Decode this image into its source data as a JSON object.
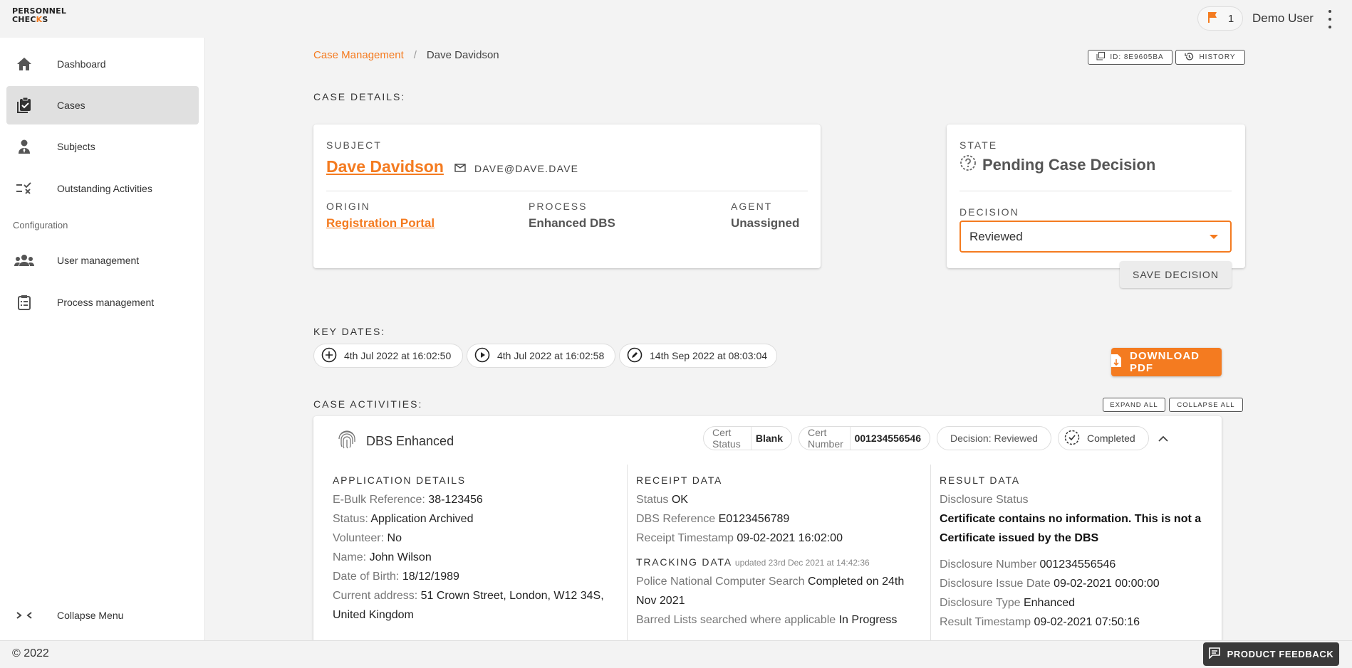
{
  "header": {
    "logo_line1": "PERSONNEL",
    "logo_line2_a": "CHEC",
    "logo_line2_k": "K",
    "logo_line2_b": "S",
    "flag_count": "1",
    "user_name": "Demo User"
  },
  "sidebar": {
    "items": [
      {
        "label": "Dashboard",
        "icon": "home-icon"
      },
      {
        "label": "Cases",
        "icon": "clipboard-check-icon"
      },
      {
        "label": "Subjects",
        "icon": "person-icon"
      },
      {
        "label": "Outstanding Activities",
        "icon": "checklist-icon"
      },
      {
        "label": "User management",
        "icon": "group-icon"
      },
      {
        "label": "Process management",
        "icon": "clipboard-list-icon"
      }
    ],
    "section_label": "Configuration",
    "collapse_label": "Collapse Menu"
  },
  "breadcrumb": {
    "parent": "Case Management",
    "separator": "/",
    "current": "Dave Davidson"
  },
  "actions": {
    "id_label": "ID: 8E9605BA",
    "history_label": "HISTORY"
  },
  "case_details": {
    "title": "CASE DETAILS:",
    "subject_label": "SUBJECT",
    "subject_name": "Dave Davidson",
    "subject_email": "DAVE@DAVE.DAVE",
    "origin_label": "ORIGIN",
    "origin_value": "Registration Portal",
    "process_label": "PROCESS",
    "process_value": "Enhanced DBS",
    "agent_label": "AGENT",
    "agent_value": "Unassigned"
  },
  "state": {
    "label": "STATE",
    "value": "Pending Case Decision",
    "decision_label": "DECISION",
    "decision_value": "Reviewed",
    "save_label": "SAVE DECISION"
  },
  "key_dates": {
    "title": "KEY DATES:",
    "created": "4th Jul 2022 at 16:02:50",
    "started": "4th Jul 2022 at 16:02:58",
    "edited": "14th Sep 2022 at 08:03:04",
    "download_label": "DOWNLOAD PDF"
  },
  "case_activities": {
    "title": "CASE ACTIVITIES:",
    "expand_all": "EXPAND ALL",
    "collapse_all": "COLLAPSE ALL",
    "activity": {
      "name": "DBS Enhanced",
      "cert_status_label": "Cert Status",
      "cert_status_value": "Blank",
      "cert_number_label": "Cert Number",
      "cert_number_value": "001234556546",
      "decision_text": "Decision: Reviewed",
      "status": "Completed",
      "application": {
        "title": "APPLICATION DETAILS",
        "ebulk_label": "E-Bulk Reference:",
        "ebulk_value": "38-123456",
        "status_label": "Status:",
        "status_value": "Application Archived",
        "volunteer_label": "Volunteer:",
        "volunteer_value": "No",
        "name_label": "Name:",
        "name_value": "John Wilson",
        "dob_label": "Date of Birth:",
        "dob_value": "18/12/1989",
        "address_label": "Current address:",
        "address_value_1": "51 Crown Street, London, W12 34S,",
        "address_value_2": "United Kingdom"
      },
      "receipt": {
        "title": "RECEIPT DATA",
        "status_label": "Status",
        "status_value": "OK",
        "dbsref_label": "DBS Reference",
        "dbsref_value": "E0123456789",
        "timestamp_label": "Receipt Timestamp",
        "timestamp_value": "09-02-2021 16:02:00",
        "tracking_title": "TRACKING DATA",
        "tracking_updated": "updated 23rd Dec 2021 at 14:42:36",
        "pnc_label": "Police National Computer Search",
        "pnc_value_1": "Completed on 24th",
        "pnc_value_2": "Nov 2021",
        "barred_label": "Barred Lists searched where applicable",
        "barred_value": "In Progress"
      },
      "result": {
        "title": "RESULT DATA",
        "disclosure_status_label": "Disclosure Status",
        "disclosure_status_1": "Certificate contains no information. This is not a",
        "disclosure_status_2": "Certificate issued by the DBS",
        "number_label": "Disclosure Number",
        "number_value": "001234556546",
        "issue_label": "Disclosure Issue Date",
        "issue_value": "09-02-2021 00:00:00",
        "type_label": "Disclosure Type",
        "type_value": "Enhanced",
        "result_ts_label": "Result Timestamp",
        "result_ts_value": "09-02-2021 07:50:16"
      }
    }
  },
  "footer": {
    "copyright": "© 2022",
    "feedback_label": "PRODUCT FEEDBACK"
  },
  "colors": {
    "accent": "#f47b20",
    "sidebar_active": "#e0e0e0",
    "dark_button": "#3a3a3a"
  }
}
